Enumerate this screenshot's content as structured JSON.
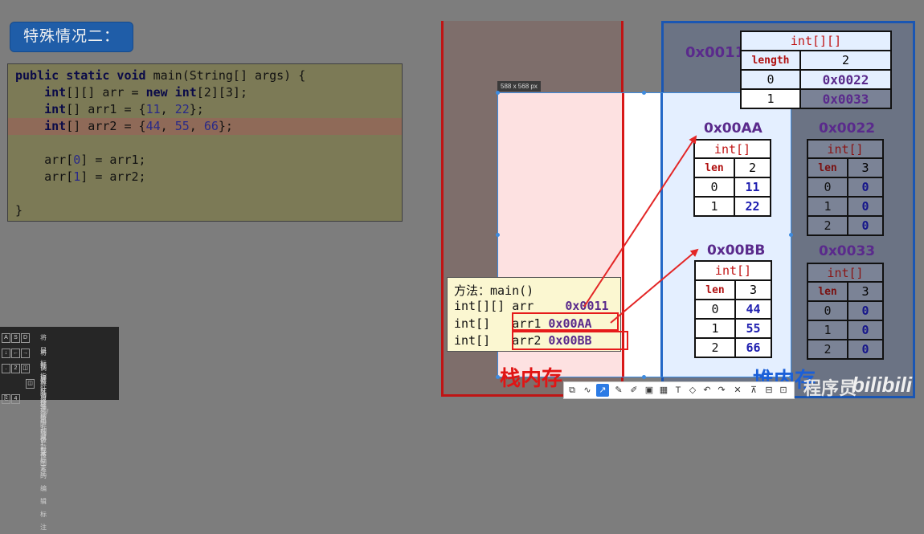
{
  "title": "特殊情况二：",
  "code": {
    "l1_kw": "public static void",
    "l1_rest": " main(String[] args) {",
    "l2_kw1": "int",
    "l2_mid": "[][] arr = ",
    "l2_kw2": "new int",
    "l2_rest": "[2][3];",
    "l3_kw": "int",
    "l3_a": "[] arr1 = {",
    "l3_n1": "11",
    "l3_b": ", ",
    "l3_n2": "22",
    "l3_c": "};",
    "l4_kw": "int",
    "l4_a": "[] arr2 = {",
    "l4_n1": "44",
    "l4_b": ", ",
    "l4_n2": "55",
    "l4_c": ", ",
    "l4_n3": "66",
    "l4_d": "};",
    "l5_a": "arr[",
    "l5_n": "0",
    "l5_b": "] = arr1;",
    "l6_a": "arr[",
    "l6_n": "1",
    "l6_b": "] = arr2;",
    "l7": "}"
  },
  "size_label": "588 x 568 px",
  "outer_array": {
    "addr": "0x0011",
    "type": "int[][]",
    "len_label": "length",
    "len_value": "2",
    "rows": [
      {
        "idx": "0",
        "val": "0x0022"
      },
      {
        "idx": "1",
        "val": "0x0033"
      }
    ]
  },
  "arr_aa": {
    "addr": "0x00AA",
    "type": "int[]",
    "len_label": "len",
    "len_value": "2",
    "rows": [
      {
        "idx": "0",
        "val": "11"
      },
      {
        "idx": "1",
        "val": "22"
      }
    ]
  },
  "arr_bb": {
    "addr": "0x00BB",
    "type": "int[]",
    "len_label": "len",
    "len_value": "3",
    "rows": [
      {
        "idx": "0",
        "val": "44"
      },
      {
        "idx": "1",
        "val": "55"
      },
      {
        "idx": "2",
        "val": "66"
      }
    ]
  },
  "arr_22": {
    "addr": "0x0022",
    "type": "int[]",
    "len_label": "len",
    "len_value": "3",
    "rows": [
      {
        "idx": "0",
        "val": "0"
      },
      {
        "idx": "1",
        "val": "0"
      },
      {
        "idx": "2",
        "val": "0"
      }
    ]
  },
  "arr_33": {
    "addr": "0x0033",
    "type": "int[]",
    "len_label": "len",
    "len_value": "3",
    "rows": [
      {
        "idx": "0",
        "val": "0"
      },
      {
        "idx": "1",
        "val": "0"
      },
      {
        "idx": "2",
        "val": "0"
      }
    ]
  },
  "method": {
    "header": "方法：main()",
    "r1_type": "int[][] arr",
    "r1_addr": "0x0011",
    "r2_type": "int[]",
    "r2_name": "arr1",
    "r2_addr": "0x00AA",
    "r3_type": "int[]",
    "r3_name": "arr2",
    "r3_addr": "0x00BB"
  },
  "stack_label": "栈内存",
  "heap_label": "堆内存",
  "watermark": "程序员",
  "watermark_brand": "bilibili",
  "colors": {
    "stack_red": "#d91717",
    "heap_blue": "#1a56b3",
    "address_purple": "#5a2a8c",
    "arrow_red": "#e32626"
  },
  "toolbar_icons": [
    "copy-icon",
    "curve-icon",
    "pen-icon",
    "pencil-icon",
    "marker-icon",
    "crop-icon",
    "mosaic-icon",
    "text-icon",
    "eraser-icon",
    "undo-icon",
    "redo-icon",
    "close-icon",
    "pin-icon",
    "save-icon",
    "done-icon"
  ],
  "help": [
    {
      "keys": [
        "A",
        "S",
        "D"
      ],
      "text": "将鼠标指针移动 1 像素"
    },
    {
      "keys": [
        "↓",
        "←",
        "→"
      ],
      "text": "将截屏区域移动 1 像素"
    },
    {
      "keys": [
        ".",
        "2"
      ],
      "text": "调整画笔粗细"
    },
    {
      "keys": [],
      "text": "取消选中当前标注"
    },
    {
      "keys": [
        "⎘",
        "4"
      ],
      "text": "显示/隐藏截图的编辑标注"
    }
  ]
}
